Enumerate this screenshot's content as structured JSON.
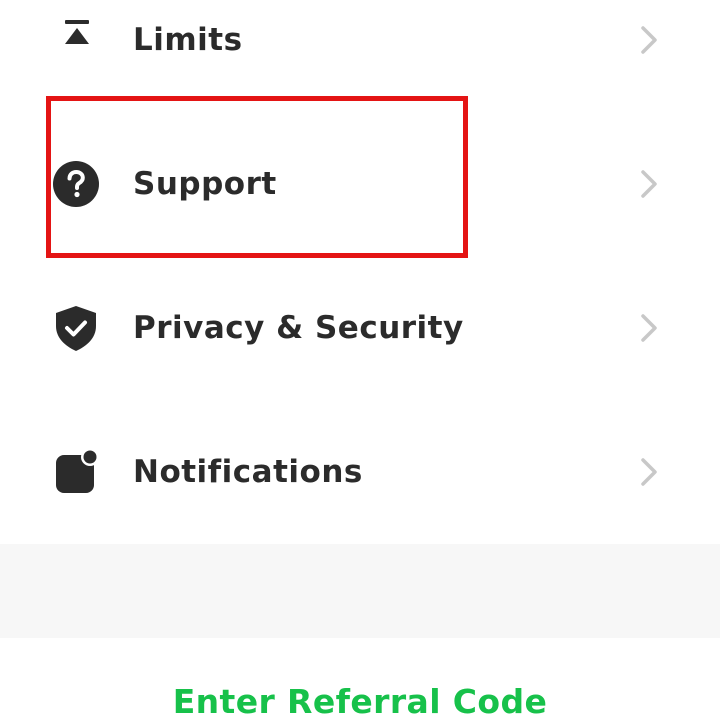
{
  "menu": {
    "items": [
      {
        "label": "Limits",
        "icon": "limits-icon"
      },
      {
        "label": "Support",
        "icon": "question-circle-icon"
      },
      {
        "label": "Privacy & Security",
        "icon": "shield-check-icon"
      },
      {
        "label": "Notifications",
        "icon": "notification-badge-icon"
      }
    ],
    "highlighted_item": "Support"
  },
  "referral": {
    "label": "Enter Referral Code"
  },
  "colors": {
    "accent": "#17c14a",
    "highlight_border": "#e41414",
    "text": "#2b2b2b",
    "chevron": "#c8c8c8",
    "band": "#f7f7f7"
  }
}
